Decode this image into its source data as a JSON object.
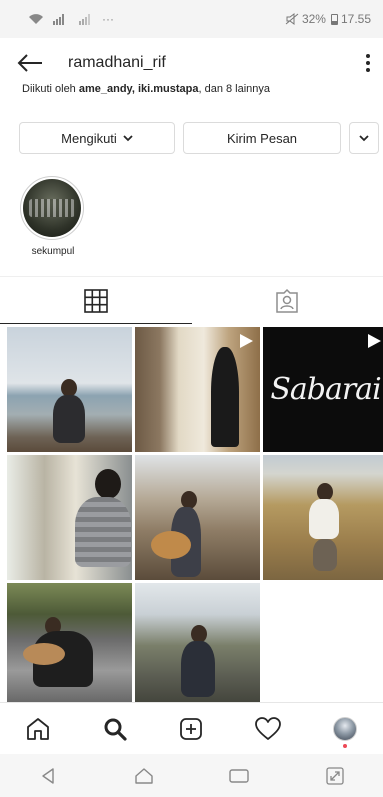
{
  "status": {
    "battery": "32%",
    "time": "17.55",
    "dots": "···"
  },
  "header": {
    "username": "ramadhani_rif"
  },
  "profile": {
    "followed_prefix": "Diikuti oleh ",
    "followed_names": "ame_andy, iki.mustapa",
    "followed_suffix": ", dan 8 lainnya"
  },
  "actions": {
    "follow_label": "Mengikuti",
    "message_label": "Kirim Pesan"
  },
  "highlights": [
    {
      "label": "sekumpul"
    }
  ],
  "posts": [
    {
      "type": "photo"
    },
    {
      "type": "video"
    },
    {
      "type": "video",
      "caption": "Sabarai"
    },
    {
      "type": "photo"
    },
    {
      "type": "photo"
    },
    {
      "type": "photo"
    },
    {
      "type": "photo"
    },
    {
      "type": "photo"
    }
  ],
  "icons": {
    "back": "arrow-left-icon",
    "more": "kebab-icon",
    "grid": "grid-icon",
    "tagged": "tagged-icon",
    "home": "home-icon",
    "search": "search-icon",
    "add": "plus-square-icon",
    "activity": "heart-icon"
  },
  "colors": {
    "accent": "#262626",
    "notification": "#ed4956",
    "border": "#dbdbdb"
  }
}
